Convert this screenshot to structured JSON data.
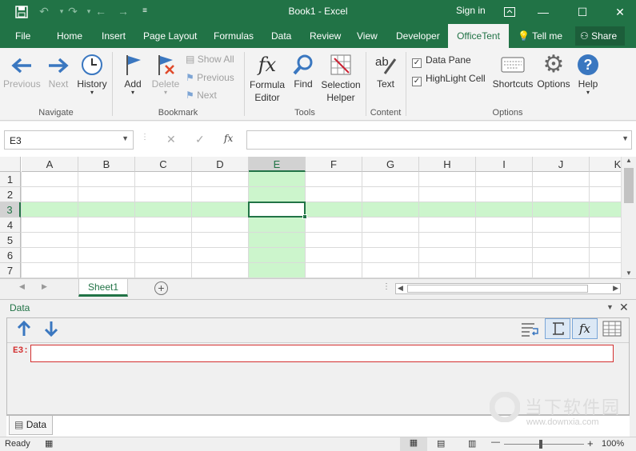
{
  "window": {
    "title": "Book1 - Excel",
    "signin": "Sign in"
  },
  "tabs": [
    "File",
    "Home",
    "Insert",
    "Page Layout",
    "Formulas",
    "Data",
    "Review",
    "View",
    "Developer",
    "OfficeTent"
  ],
  "tell_me": "Tell me",
  "share": "Share",
  "ribbon": {
    "navigate": {
      "previous": "Previous",
      "next": "Next",
      "history": "History",
      "label": "Navigate"
    },
    "bookmark": {
      "add": "Add",
      "delete": "Delete",
      "show_all": "Show All",
      "previous": "Previous",
      "next": "Next",
      "label": "Bookmark"
    },
    "tools": {
      "formula_editor": "Formula\nEditor",
      "find": "Find",
      "selection_helper": "Selection\nHelper",
      "label": "Tools"
    },
    "content": {
      "text": "Text",
      "label": "Content"
    },
    "options": {
      "data_pane": "Data Pane",
      "highlight_cell": "HighLight Cell",
      "shortcuts": "Shortcuts",
      "options": "Options",
      "help": "Help",
      "label": "Options"
    }
  },
  "formula_bar": {
    "name_box": "E3",
    "fx": "fx",
    "value": ""
  },
  "sheet": {
    "columns": [
      "A",
      "B",
      "C",
      "D",
      "E",
      "F",
      "G",
      "H",
      "I",
      "J",
      "K"
    ],
    "rows": [
      "1",
      "2",
      "3",
      "4",
      "5",
      "6",
      "7"
    ],
    "selected_col": "E",
    "selected_row": "3",
    "highlight_color": "#ccf5cc"
  },
  "sheet_tab": "Sheet1",
  "data_pane": {
    "title": "Data",
    "cell_ref": "E3:",
    "tab": "Data"
  },
  "status": {
    "ready": "Ready",
    "zoom": "100%"
  },
  "watermark": {
    "text1": "当下软件园",
    "text2": "www.downxia.com"
  },
  "colors": {
    "accent": "#217346",
    "error_border": "#d33030"
  }
}
